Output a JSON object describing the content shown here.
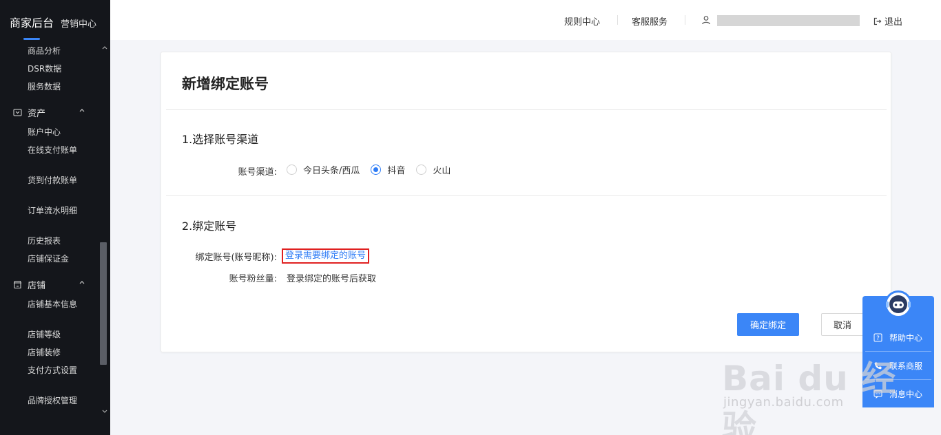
{
  "sidebar": {
    "brand_title": "商家后台",
    "brand_sub": "营销中心",
    "top_items": [
      "商品分析",
      "DSR数据",
      "服务数据"
    ],
    "group_assets": {
      "label": "资产",
      "items": [
        "账户中心",
        "在线支付账单",
        "货到付款账单",
        "订单流水明细",
        "历史报表",
        "店铺保证金"
      ]
    },
    "group_shop": {
      "label": "店铺",
      "items": [
        "店铺基本信息",
        "店铺等级",
        "店铺装修",
        "支付方式设置",
        "品牌授权管理"
      ]
    }
  },
  "header": {
    "rules_center": "规则中心",
    "customer_service": "客服服务",
    "logout": "退出"
  },
  "card": {
    "title": "新增绑定账号",
    "section1_title": "1.选择账号渠道",
    "channel_label": "账号渠道:",
    "channels": [
      "今日头条/西瓜",
      "抖音",
      "火山"
    ],
    "selected_channel": "抖音",
    "section2_title": "2.绑定账号",
    "bind_label": "绑定账号(账号昵称):",
    "bind_link": "登录需要绑定的账号",
    "fans_label": "账号粉丝量:",
    "fans_value": "登录绑定的账号后获取",
    "confirm_button": "确定绑定",
    "cancel_button": "取消"
  },
  "float_panel": {
    "help_center": "帮助中心",
    "contact_service": "联系商服",
    "message_center": "消息中心"
  },
  "watermark": {
    "main": "Bai du 经验",
    "sub": "jingyan.baidu.com"
  },
  "colors": {
    "sidebar_bg": "#14161b",
    "accent": "#3b86f7",
    "highlight_border": "#e02020"
  }
}
